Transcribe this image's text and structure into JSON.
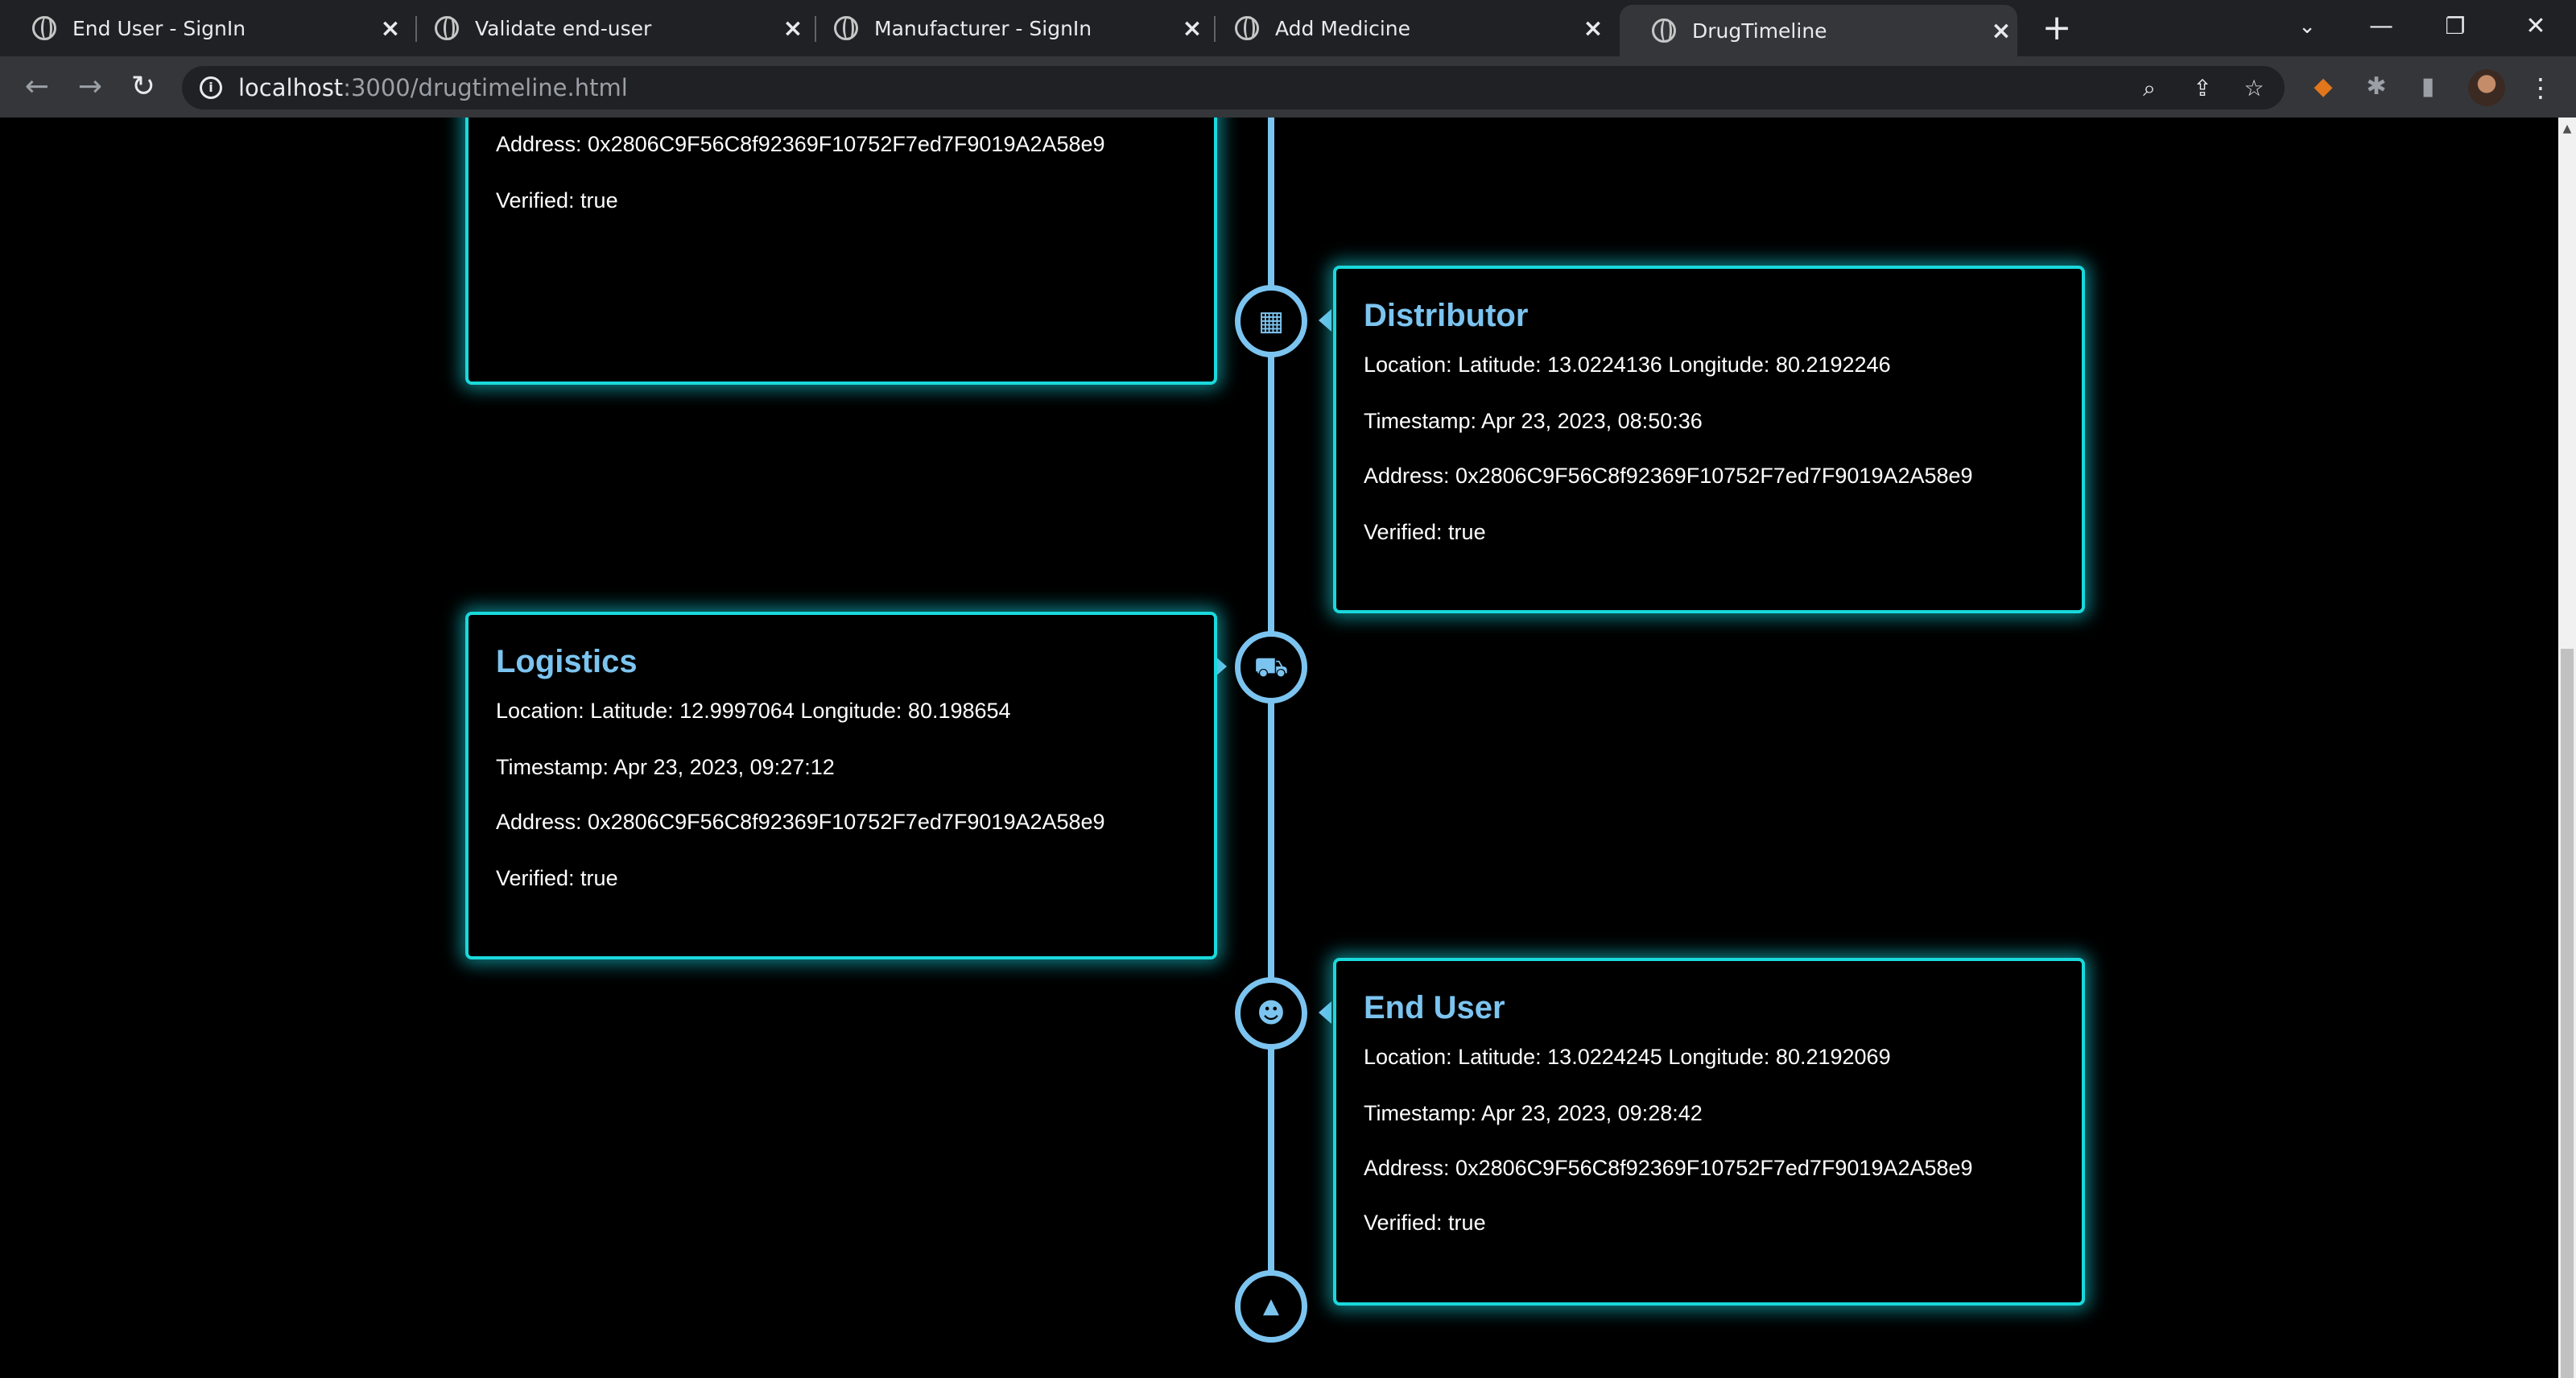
{
  "browser": {
    "tabs": [
      {
        "title": "End User - SignIn"
      },
      {
        "title": "Validate end-user"
      },
      {
        "title": "Manufacturer - SignIn"
      },
      {
        "title": "Add Medicine"
      },
      {
        "title": "DrugTimeline"
      }
    ],
    "url_host": "localhost",
    "url_path": ":3000/drugtimeline.html"
  },
  "timeline": {
    "top_partial": {
      "address": "Address: 0x2806C9F56C8f92369F10752F7ed7F9019A2A58e9",
      "verified": "Verified: true"
    },
    "entries": [
      {
        "role": "Distributor",
        "location": "Location: Latitude: 13.0224136 Longitude: 80.2192246",
        "timestamp": "Timestamp: Apr 23, 2023, 08:50:36",
        "address": "Address: 0x2806C9F56C8f92369F10752F7ed7F9019A2A58e9",
        "verified": "Verified: true",
        "icon": "building-icon"
      },
      {
        "role": "Logistics",
        "location": "Location: Latitude: 12.9997064 Longitude: 80.198654",
        "timestamp": "Timestamp: Apr 23, 2023, 09:27:12",
        "address": "Address: 0x2806C9F56C8f92369F10752F7ed7F9019A2A58e9",
        "verified": "Verified: true",
        "icon": "truck-icon"
      },
      {
        "role": "End User",
        "location": "Location: Latitude: 13.0224245 Longitude: 80.2192069",
        "timestamp": "Timestamp: Apr 23, 2023, 09:28:42",
        "address": "Address: 0x2806C9F56C8f92369F10752F7ed7F9019A2A58e9",
        "verified": "Verified: true",
        "icon": "users-icon"
      }
    ],
    "end_icon": "caret-up-icon"
  },
  "colors": {
    "accent": "#7cc4f0",
    "glow": "#1ad9dc",
    "background": "#000000"
  }
}
